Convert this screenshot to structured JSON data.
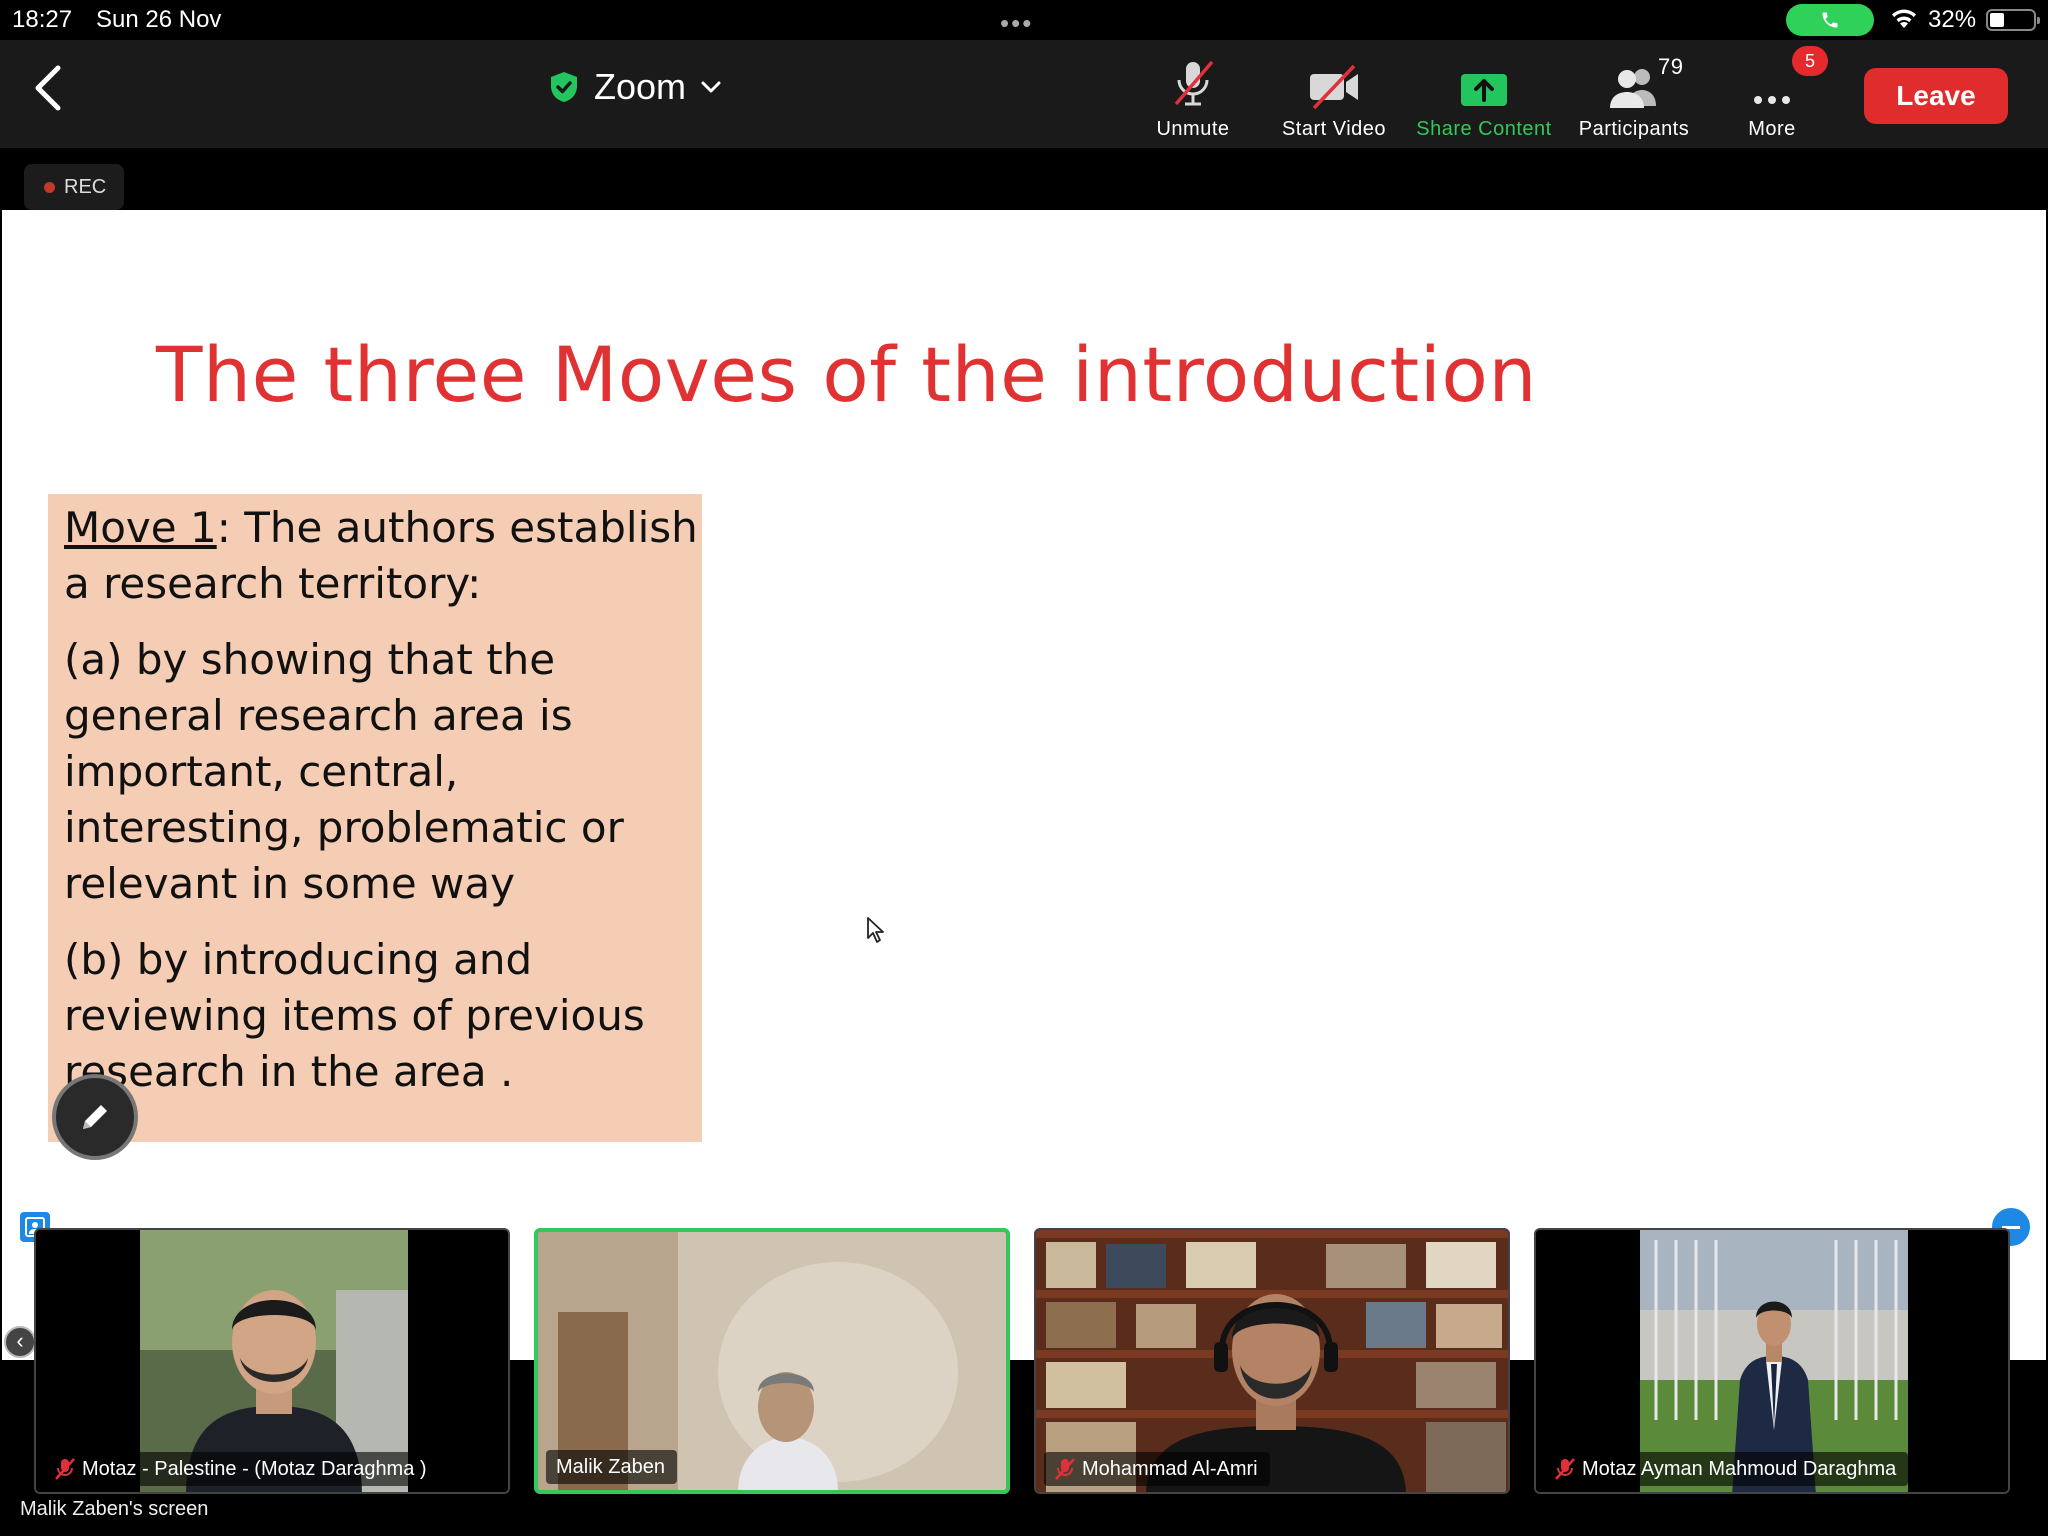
{
  "status_bar": {
    "time": "18:27",
    "date": "Sun 26 Nov",
    "battery": "32%"
  },
  "toolbar": {
    "title": "Zoom",
    "unmute": "Unmute",
    "start_video": "Start Video",
    "share_content": "Share Content",
    "participants": "Participants",
    "participant_count": "79",
    "more": "More",
    "more_badge": "5",
    "leave": "Leave"
  },
  "rec_label": "REC",
  "slide": {
    "title": "The three Moves of the introduction",
    "move_label": "Move 1",
    "move_text": ": The authors establish a research territory:",
    "point_a": "(a) by showing that the general research area is important, central, interesting, problematic or relevant in some way",
    "point_b": "(b) by introducing and reviewing items of previous research in the area ."
  },
  "participants": [
    {
      "name": "Motaz - Palestine - (Motaz Daraghma )",
      "muted": true
    },
    {
      "name": "Malik Zaben",
      "muted": false
    },
    {
      "name": "Mohammad Al-Amri",
      "muted": true
    },
    {
      "name": "Motaz Ayman Mahmoud Daraghma",
      "muted": true
    }
  ],
  "screen_label": "Malik Zaben's screen",
  "colors": {
    "leave": "#e02c2c",
    "share": "#34c759",
    "slide_title": "#e03232",
    "move_box": "#f5cdb4"
  }
}
